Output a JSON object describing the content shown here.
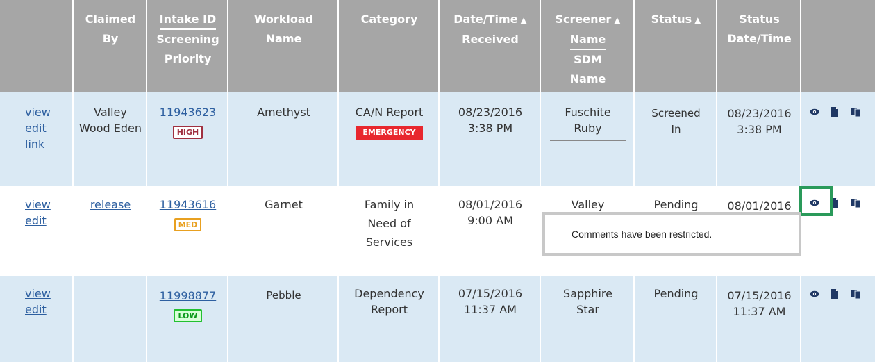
{
  "header": {
    "claimed_by": [
      "Claimed",
      "By"
    ],
    "intake_id": "Intake ID",
    "screening_priority": [
      "Screening",
      "Priority"
    ],
    "workload_name": [
      "Workload",
      "Name"
    ],
    "category": "Category",
    "date_time_received": [
      "Date/Time",
      "Received"
    ],
    "screener_name": [
      "Screener",
      "Name"
    ],
    "sdm_name": [
      "SDM",
      "Name"
    ],
    "status": "Status",
    "status_date_time": [
      "Status",
      "Date/Time"
    ],
    "sort_icon": "sort-icon"
  },
  "rows": [
    {
      "actions": [
        "view",
        "edit",
        "link"
      ],
      "claimed_by": [
        "Valley",
        "Wood Eden"
      ],
      "intake_id": "11943623",
      "priority": "HIGH",
      "workload_name": "Amethyst",
      "category": [
        "CA/N Report"
      ],
      "category_badge": "EMERGENCY",
      "date_received": "08/23/2016",
      "time_received": "3:38 PM",
      "screener": [
        "Fuschite",
        "Ruby"
      ],
      "status": [
        "Screened",
        "In"
      ],
      "status_date": "08/23/2016",
      "status_time": "3:38 PM"
    },
    {
      "actions": [
        "view",
        "edit"
      ],
      "claimed_by_link": "release",
      "intake_id": "11943616",
      "priority": "MED",
      "workload_name": "Garnet",
      "category": [
        "Family in",
        "Need of",
        "Services"
      ],
      "date_received": "08/01/2016",
      "time_received": "9:00 AM",
      "screener": [
        "Valley"
      ],
      "status": [
        "Pending"
      ],
      "status_date": "08/01/2016"
    },
    {
      "actions": [
        "view",
        "edit"
      ],
      "intake_id": "11998877",
      "priority": "LOW",
      "workload_name": "Pebble",
      "category": [
        "Dependency",
        "Report"
      ],
      "date_received": "07/15/2016",
      "time_received": "11:37 AM",
      "screener": [
        "Sapphire",
        "Star"
      ],
      "status": [
        "Pending"
      ],
      "status_date": "07/15/2016",
      "status_time": "11:37 AM"
    }
  ],
  "tooltip": "Comments have been restricted.",
  "icons": [
    "eye-icon",
    "document-icon",
    "copy-documents-icon"
  ],
  "colors": {
    "header_bg": "#a6a6a6",
    "row_alt_bg": "#dae9f4",
    "link": "#2d5fa0",
    "high": "#a03040",
    "med": "#e8a020",
    "low": "#22c030",
    "emergency": "#e8272e",
    "highlight": "#2a9a5a"
  }
}
